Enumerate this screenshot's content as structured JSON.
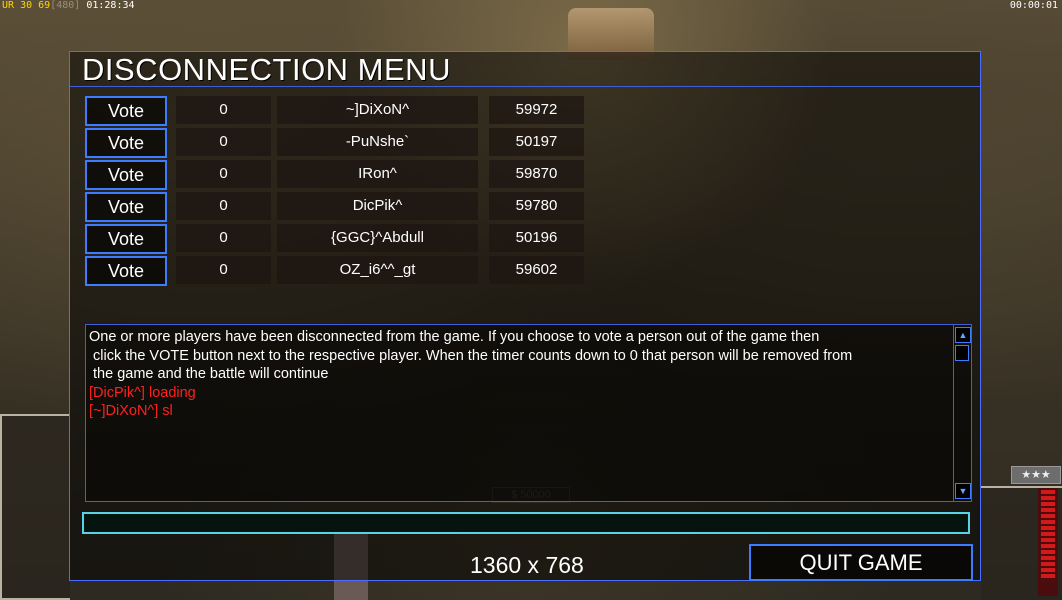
{
  "hud": {
    "ur": "UR",
    "fps": "30",
    "fps2": "69",
    "bracket": "[480]",
    "clock": "01:28:34",
    "timer": "00:00:01"
  },
  "panel": {
    "title": "DISCONNECTION MENU",
    "vote_label": "Vote",
    "players": [
      {
        "count": "0",
        "name": "~]DiXoN^",
        "ping": "59972"
      },
      {
        "count": "0",
        "name": "-PuNshe`",
        "ping": "50197"
      },
      {
        "count": "0",
        "name": "IRon^",
        "ping": "59870"
      },
      {
        "count": "0",
        "name": "DicPik^",
        "ping": "59780"
      },
      {
        "count": "0",
        "name": "{GGC}^Abdull",
        "ping": "50196"
      },
      {
        "count": "0",
        "name": "OZ_i6^^_gt",
        "ping": "59602"
      }
    ],
    "message": {
      "line1": "One or more players have been disconnected from the game. If you choose to vote a person out of the game then",
      "line2": " click the VOTE button next to the respective player. When the timer counts down to 0 that person will be removed from",
      "line3": " the game and the battle will continue",
      "red1": "[DicPik^] loading",
      "red2": "[~]DiXoN^] sl"
    },
    "chat_value": "",
    "resolution": "1360 x 768",
    "quit_label": "QUIT GAME"
  },
  "background": {
    "money": "$ 50000",
    "rank": "★★★"
  },
  "colors": {
    "frame": "#4a6dff",
    "button_border": "#3d7cff",
    "chat_border": "#5ad2e6",
    "alert": "#ff2020"
  }
}
